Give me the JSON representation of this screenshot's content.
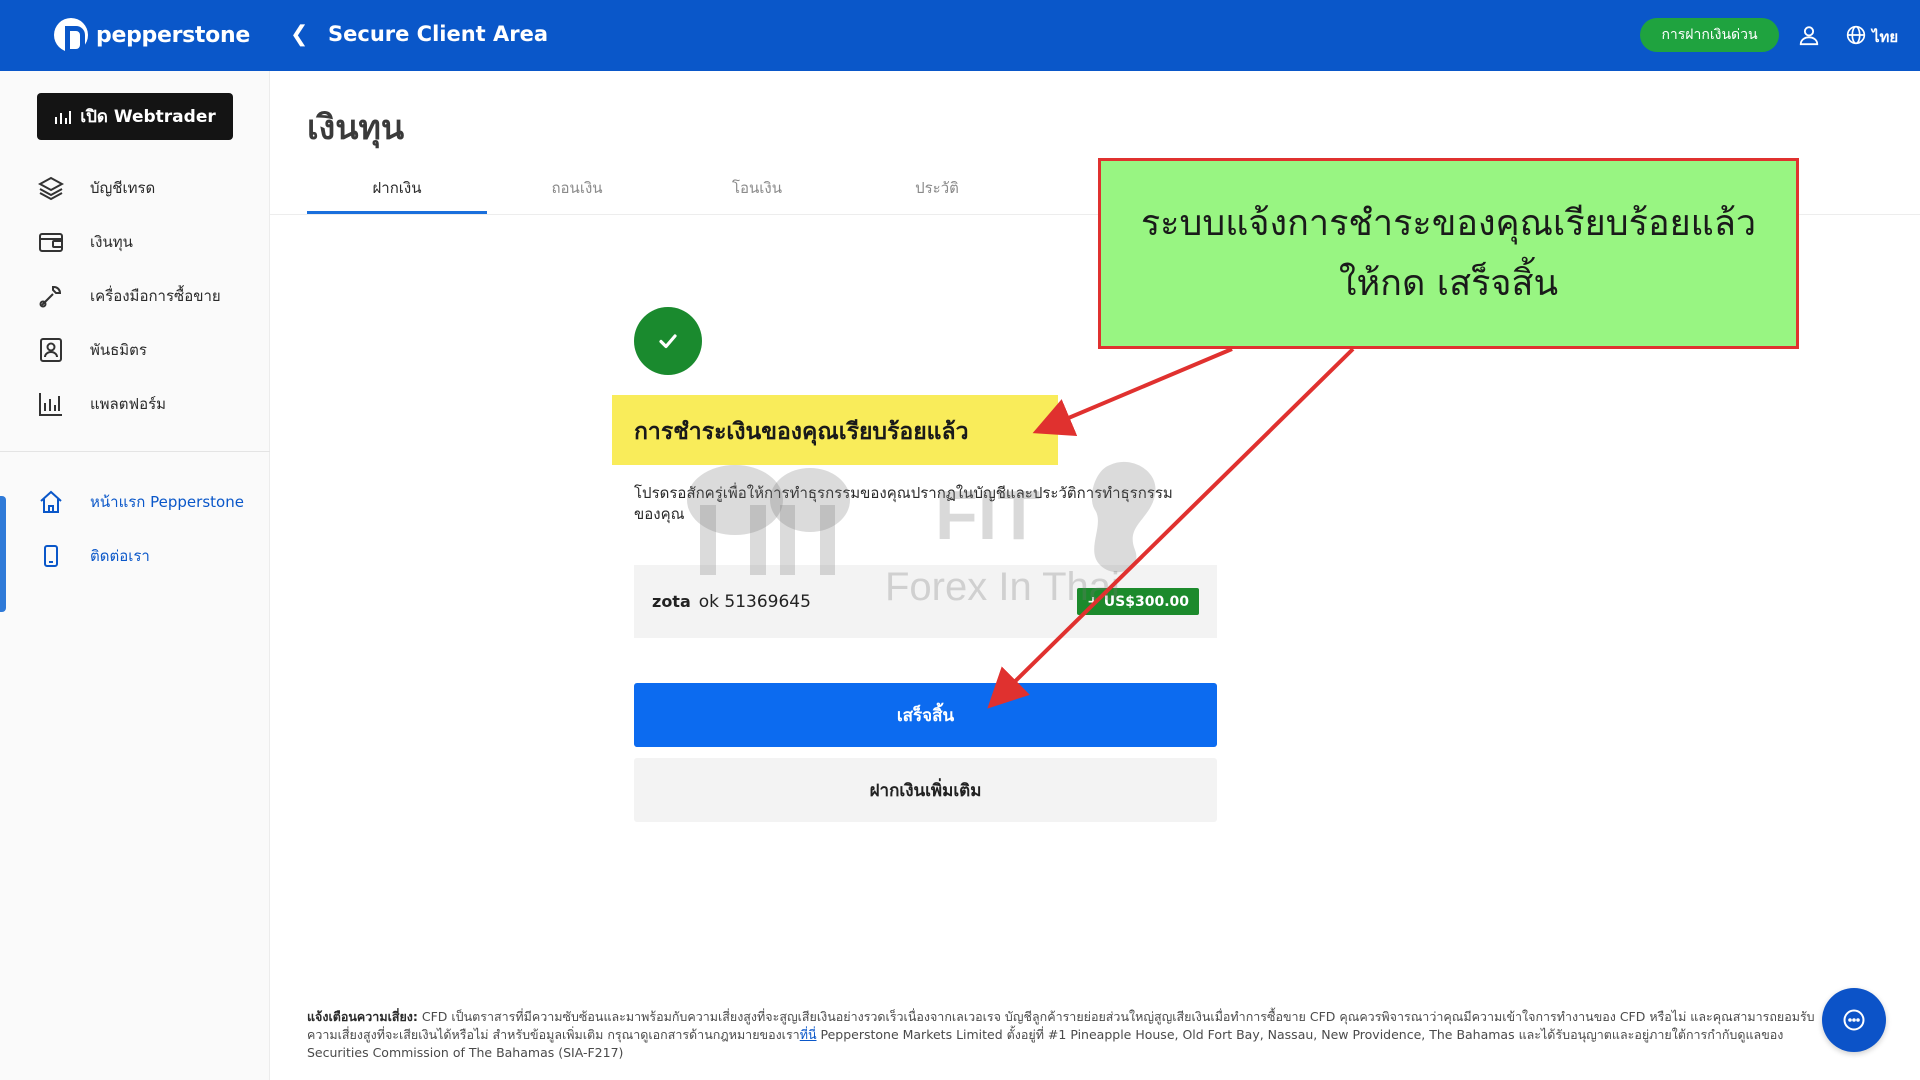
{
  "header": {
    "brand": "pepperstone",
    "title": "Secure Client Area",
    "quick_deposit": "การฝากเงินด่วน",
    "language": "ไทย"
  },
  "sidebar": {
    "webtrader_label": "เปิด Webtrader",
    "items": [
      {
        "label": "บัญชีเทรด",
        "icon": "layers-icon"
      },
      {
        "label": "เงินทุน",
        "icon": "wallet-icon"
      },
      {
        "label": "เครื่องมือการซื้อขาย",
        "icon": "tools-icon"
      },
      {
        "label": "พันธมิตร",
        "icon": "partner-icon"
      },
      {
        "label": "แพลตฟอร์ม",
        "icon": "chart-icon"
      }
    ],
    "links": [
      {
        "label": "หน้าแรก Pepperstone",
        "icon": "home-icon"
      },
      {
        "label": "ติดต่อเรา",
        "icon": "phone-icon"
      }
    ]
  },
  "main": {
    "page_title": "เงินทุน",
    "tabs": [
      {
        "label": "ฝากเงิน",
        "active": true
      },
      {
        "label": "ถอนเงิน",
        "active": false
      },
      {
        "label": "โอนเงิน",
        "active": false
      },
      {
        "label": "ประวัติ",
        "active": false
      }
    ],
    "success_title": "การชำระเงินของคุณเรียบร้อยแล้ว",
    "success_subtitle": "โปรดรอสักครู่เพื่อให้การทำธุรกรรมของคุณปรากฏในบัญชีและประวัติการทำธุรกรรมของคุณ",
    "transaction": {
      "provider": "zοta",
      "reference": "ok 51369645",
      "amount": "+ US$300.00"
    },
    "finish_button": "เสร็จสิ้น",
    "more_button": "ฝากเงินเพิ่มเติม"
  },
  "annotation": {
    "line1": "ระบบแจ้งการชำระของคุณเรียบร้อยแล้ว",
    "line2": "ให้กด เสร็จสิ้น",
    "box_color": "#98f582",
    "border_color": "#e0312f"
  },
  "watermark": {
    "logo_text": "FIT",
    "tagline": "Forex In Thai"
  },
  "disclaimer": {
    "label": "แจ้งเตือนความเสี่ยง:",
    "text1": "CFD เป็นตราสารที่มีความซับซ้อนและมาพร้อมกับความเสี่ยงสูงที่จะสูญเสียเงินอย่างรวดเร็วเนื่องจากเลเวอเรจ บัญชีลูกค้ารายย่อยส่วนใหญ่สูญเสียเงินเมื่อทำการซื้อขาย CFD คุณควรพิจารณาว่าคุณมีความเข้าใจการทำงานของ CFD หรือไม่ และคุณสามารถยอมรับความเสี่ยงสูงที่จะเสียเงินได้หรือไม่ สำหรับข้อมูลเพิ่มเติม กรุณาดูเอกสารด้านกฎหมายของเรา",
    "link": "ที่นี่",
    "text2": "Pepperstone Markets Limited ตั้งอยู่ที่ #1 Pineapple House, Old Fort Bay, Nassau, New Providence, The Bahamas และได้รับอนุญาตและอยู่ภายใต้การกำกับดูแลของ Securities Commission of The Bahamas (SIA-F217)"
  },
  "colors": {
    "header_blue": "#0a57c9",
    "success_green": "#1a8a2e",
    "primary_button": "#0c6bf0",
    "highlight_yellow": "#f9ec5a"
  }
}
